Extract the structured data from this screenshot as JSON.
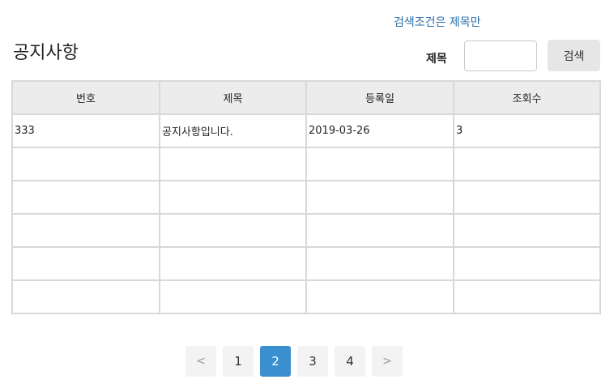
{
  "header": {
    "search_hint": "검색조건은 제목만",
    "title": "공지사항"
  },
  "search": {
    "label": "제목",
    "value": "",
    "placeholder": "",
    "button_label": "검색"
  },
  "table": {
    "columns": [
      "번호",
      "제목",
      "등록일",
      "조회수"
    ],
    "rows": [
      [
        "333",
        "공지사항입니다.",
        "2019-03-26",
        "3"
      ],
      [
        "",
        "",
        "",
        ""
      ],
      [
        "",
        "",
        "",
        ""
      ],
      [
        "",
        "",
        "",
        ""
      ],
      [
        "",
        "",
        "",
        ""
      ],
      [
        "",
        "",
        "",
        ""
      ]
    ]
  },
  "pagination": {
    "prev_label": "<",
    "next_label": ">",
    "pages": [
      "1",
      "2",
      "3",
      "4"
    ],
    "current": "2"
  },
  "colors": {
    "hint_text": "#2a6fa8",
    "active_page": "#3a8fd0",
    "header_bg": "#ececec",
    "border": "#d8d8d8"
  }
}
